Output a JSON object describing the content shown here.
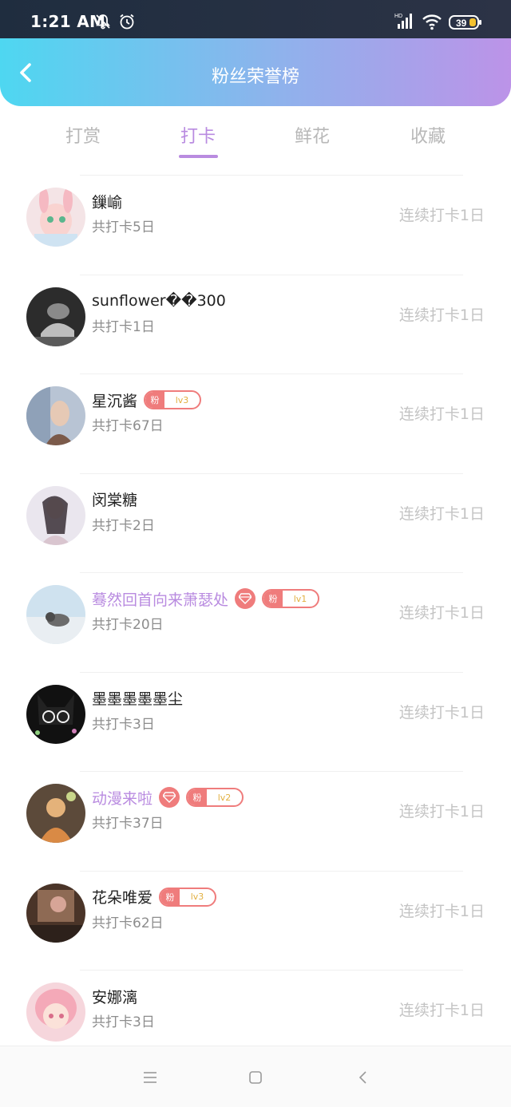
{
  "status_bar": {
    "time": "1:21 AM",
    "network_label": "HD",
    "battery": "39"
  },
  "header": {
    "title": "粉丝荣誉榜"
  },
  "tabs": [
    {
      "label": "打赏",
      "active": false
    },
    {
      "label": "打卡",
      "active": true
    },
    {
      "label": "鲜花",
      "active": false
    },
    {
      "label": "收藏",
      "active": false
    }
  ],
  "list": [
    {
      "name": "鏁崳",
      "total": "共打卡5日",
      "streak": "连续打卡1日",
      "vip": false,
      "gem": false,
      "fan_level": null,
      "fan_label": null
    },
    {
      "name": "sunflower��300",
      "total": "共打卡1日",
      "streak": "连续打卡1日",
      "vip": false,
      "gem": false,
      "fan_level": null,
      "fan_label": null
    },
    {
      "name": "星沉酱",
      "total": "共打卡67日",
      "streak": "连续打卡1日",
      "vip": false,
      "gem": false,
      "fan_level": "lv3",
      "fan_label": "粉"
    },
    {
      "name": "闵棠糖",
      "total": "共打卡2日",
      "streak": "连续打卡1日",
      "vip": false,
      "gem": false,
      "fan_level": null,
      "fan_label": null
    },
    {
      "name": "蓦然回首向来萧瑟处",
      "total": "共打卡20日",
      "streak": "连续打卡1日",
      "vip": true,
      "gem": true,
      "fan_level": "lv1",
      "fan_label": "粉"
    },
    {
      "name": "墨墨墨墨墨尘",
      "total": "共打卡3日",
      "streak": "连续打卡1日",
      "vip": false,
      "gem": false,
      "fan_level": null,
      "fan_label": null
    },
    {
      "name": "动漫来啦",
      "total": "共打卡37日",
      "streak": "连续打卡1日",
      "vip": true,
      "gem": true,
      "fan_level": "lv2",
      "fan_label": "粉"
    },
    {
      "name": "花朵唯爱",
      "total": "共打卡62日",
      "streak": "连续打卡1日",
      "vip": false,
      "gem": false,
      "fan_level": "lv3",
      "fan_label": "粉"
    },
    {
      "name": "安娜漓",
      "total": "共打卡3日",
      "streak": "连续打卡1日",
      "vip": false,
      "gem": false,
      "fan_level": null,
      "fan_label": null
    }
  ],
  "colors": {
    "accent": "#b98be0",
    "badge": "#ef7c7c",
    "header_start": "#4ed7f1",
    "header_end": "#bc93e8"
  },
  "icons": {
    "back": "chevron-left-icon",
    "gem": "diamond-icon",
    "nav_menu": "menu-icon",
    "nav_home": "square-icon",
    "nav_back": "triangle-back-icon"
  }
}
